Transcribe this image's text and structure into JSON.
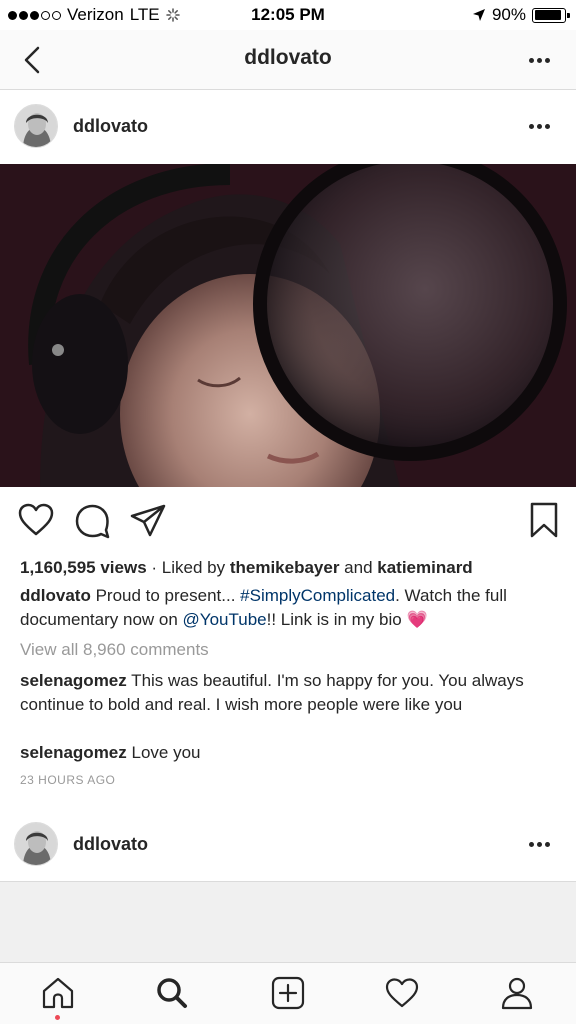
{
  "status_bar": {
    "carrier": "Verizon",
    "network": "LTE",
    "time": "12:05 PM",
    "battery": "90%",
    "battery_level": 0.9
  },
  "nav": {
    "title": "ddlovato",
    "back_icon": "chevron-left-icon",
    "more_icon": "more-horizontal-icon"
  },
  "post": {
    "username": "ddlovato",
    "views": "1,160,595 views",
    "liked_prefix": " · Liked by ",
    "liked_user1": "themikebayer",
    "liked_and": " and ",
    "liked_user2": "katieminard",
    "caption_user": "ddlovato",
    "caption_part1": " Proud to present... ",
    "caption_hashtag": "#SimplyComplicated",
    "caption_part2": ". Watch the full documentary now on ",
    "caption_mention": "@YouTube",
    "caption_part3": "!! Link is in my bio ",
    "caption_emoji": "💗",
    "view_all": "View all 8,960 comments",
    "comments": [
      {
        "user": "selenagomez",
        "text": " This was beautiful. I'm so happy for you. You always continue to bold and real. I wish more people were like you"
      },
      {
        "user": "selenagomez",
        "text": " Love you"
      }
    ],
    "timestamp": "23 HOURS AGO"
  },
  "next_post": {
    "username": "ddlovato"
  },
  "tabbar": {
    "icons": [
      "home-icon",
      "search-icon",
      "add-post-icon",
      "heart-icon",
      "profile-icon"
    ]
  },
  "colors": {
    "link": "#003569",
    "notification_dot": "#ed4956",
    "muted": "#999999"
  }
}
